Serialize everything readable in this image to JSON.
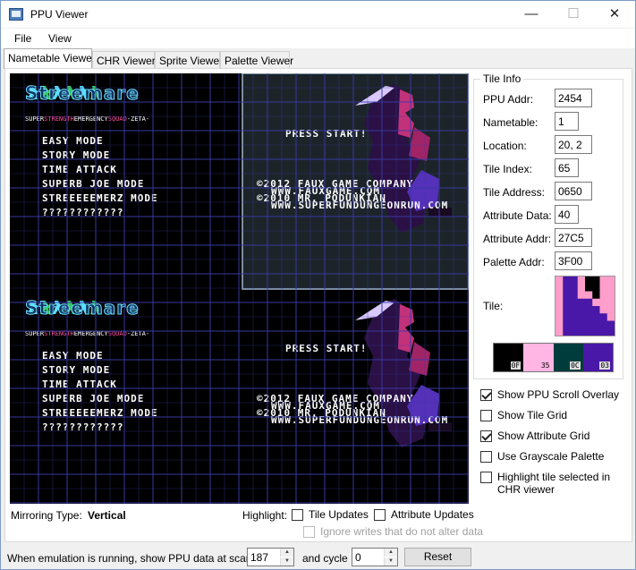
{
  "window": {
    "title": "PPU Viewer",
    "minimize": "—",
    "maximize": "☐",
    "close": "✕"
  },
  "menu": [
    "File",
    "View"
  ],
  "tabs": [
    "Nametable Viewer",
    "CHR Viewer",
    "Sprite Viewer",
    "Palette Viewer"
  ],
  "nametable": {
    "logo_text": "Streemare",
    "tagline_a": "SUPER",
    "tagline_b": "STRENGTH",
    "tagline_c": "EMERGENCY",
    "tagline_d": "SQUAD",
    "tagline_e": "-ZETA-",
    "menu_items": [
      "EASY MODE",
      "STORY MODE",
      "TIME ATTACK",
      "SUPERB JOE MODE",
      "STREEEEEMERZ MODE",
      "????????????"
    ],
    "press_start": "PRESS START!",
    "credits": [
      "©2012 FAUX GAME COMPANY",
      "WWW.FAUXGAME.COM",
      "©2010 MR. PODUNKIAN",
      "WWW.SUPERFUNDUNGEONRUN.COM"
    ],
    "mirroring_label": "Mirroring Type:",
    "mirroring_value": "Vertical",
    "highlight_label": "Highlight:",
    "tile_updates": "Tile Updates",
    "attribute_updates": "Attribute Updates",
    "ignore_writes": "Ignore writes that do not alter data"
  },
  "tile_info": {
    "legend": "Tile Info",
    "fields": [
      {
        "label": "PPU Addr:",
        "value": "2454"
      },
      {
        "label": "Nametable:",
        "value": "1"
      },
      {
        "label": "Location:",
        "value": "20, 2"
      },
      {
        "label": "Tile Index:",
        "value": "65"
      },
      {
        "label": "Tile Address:",
        "value": "0650"
      },
      {
        "label": "Attribute Data:",
        "value": "40"
      },
      {
        "label": "Attribute Addr:",
        "value": "27C5"
      },
      {
        "label": "Palette Addr:",
        "value": "3F00"
      }
    ],
    "tile_label": "Tile:",
    "palette": [
      {
        "code": "0F",
        "color": "#000000"
      },
      {
        "code": "35",
        "color": "#ffb6e4"
      },
      {
        "code": "0C",
        "color": "#003c3c"
      },
      {
        "code": "03",
        "color": "#4a18a8"
      }
    ]
  },
  "options": [
    {
      "label": "Show PPU Scroll Overlay",
      "checked": true
    },
    {
      "label": "Show Tile Grid",
      "checked": false
    },
    {
      "label": "Show Attribute Grid",
      "checked": true
    },
    {
      "label": "Use Grayscale Palette",
      "checked": false
    },
    {
      "label": "Highlight tile selected in CHR viewer",
      "checked": false
    }
  ],
  "footer": {
    "scanline_label": "When emulation is running, show PPU data at scanline",
    "scanline_value": "187",
    "cycle_label": "and cycle",
    "cycle_value": "0",
    "reset": "Reset"
  },
  "colors": {
    "grid": "#3a3aa8",
    "scroll_overlay": "#7fa6ba",
    "logo": "#6cdfff"
  }
}
